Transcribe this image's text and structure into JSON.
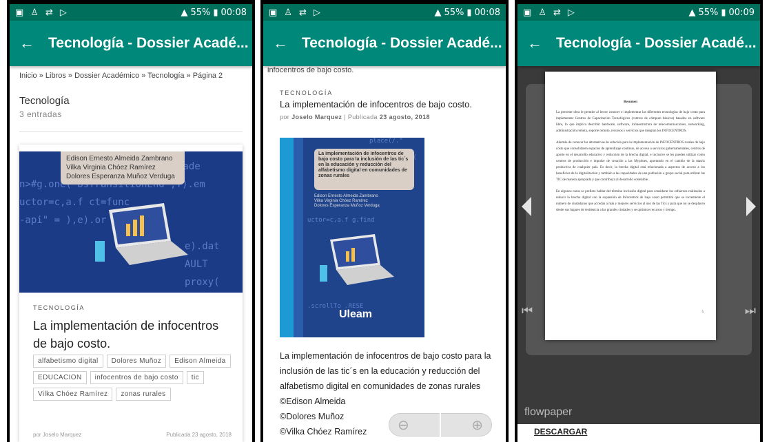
{
  "status": {
    "battery": "55%",
    "time_1": "00:08",
    "time_2": "00:08",
    "time_3": "00:09"
  },
  "appbar": {
    "title": "Tecnología - Dossier Acadé..."
  },
  "screen1": {
    "breadcrumb": "Inicio » Libros » Dossier Académico » Tecnología » Página 2",
    "category_title": "Tecnología",
    "entries": "3 entradas",
    "cover_authors": [
      "Edison Ernesto Almeida Zambrano",
      "Vilka Virginia Chóez Ramírez",
      "Dolores Esperanza Muñoz Verduga"
    ],
    "category": "TECNOLOGÍA",
    "post_title": "La implementación de infocentros de bajo costo.",
    "tags": [
      "alfabetismo digital",
      "Dolores Muñoz",
      "Edison Almeida",
      "EDUCACION",
      "infocentros de bajo costo",
      "tic",
      "Vilka Chóez Ramírez",
      "zonas rurales"
    ],
    "meta_author": "por Joselo Marquez",
    "meta_date": "Publicada 23 agosto, 2018"
  },
  "screen2": {
    "top_text": "infocentros de bajo costo.",
    "category": "TECNOLOGÍA",
    "post_title": "La implementación de infocentros de bajo costo.",
    "meta_prefix": "por",
    "meta_author": "Joselo Marquez",
    "meta_sep": "|",
    "meta_pub": "Publicada",
    "meta_date": "23 agosto, 2018",
    "book_title": "La implementación de infocentros de bajo costo para la inclusión de las tic´s en la educación y reducción del alfabetismo digital en comunidades de zonas rurales",
    "book_authors": [
      "Edison Ernesto Almeida Zambrano",
      "Vilka Virginia Chóez Ramírez",
      "Dolores Esperanza Muñoz Verduga"
    ],
    "book_logo": "Uleam",
    "desc_line1": "La implementación de infocentros de bajo costo para la",
    "desc_line2": "inclusión de las tic´s en la educación y reducción del",
    "desc_line3": "alfabetismo digital en comunidades de zonas rurales",
    "credit1": "©Edison Almeida",
    "credit2": "©Dolores Muñoz",
    "credit3": "©Vilka Chóez Ramírez"
  },
  "screen3": {
    "doc_heading": "Resumen",
    "doc_p1": "La presente obra le permite al lector conocer e implementar las diferentes tecnologías de bajo costo para implementar Centros de Capacitación Tecnológicos (centros de cómputo básicos) basados en software libre, lo que implica describir hardware, software, infraestructura de telecomunicaciones, networking, administración remota, soporte remoto, recursos y servicios que integran los INFOCENTROS.",
    "doc_p2": "Además de conocer las alternativas de solución para la implementación de INFOCENTROS rurales de bajo costo que consolidaren espacios de aprendizaje continuo, de acceso a servicios gubernamentales, centros de aporte en el desarrollo educativo y reducción de la brecha digital, e inclusive se les pueden utilizar como centros de producción e impulso de creación a las Mypimes, aportando en el cambio de la matriz productiva de cualquier país. Es decir, la brecha digital está relacionada a aspectos de acceso a los beneficios de la digitalización y también a las capacidades de una población o grupo social para utilizar las TIC de manera apropiada y que contribuya al desarrollo sostenible.",
    "doc_p3": "En algunos casos se prefiere hablar del término inclusión digital para considerar los esfuerzos realizados a reducir la brecha digital con la expansión de Infocentros de bajo costo permitirá que se incremente el número de ciudadanos que accedan a más y mejores servicios al uso de las Tics y para que no se desplacen desde sus lugares de residencia a las grandes ciudades y se optimice recursos y tiempo.",
    "page_number": "5",
    "viewer_brand": "flowpaper",
    "download": "DESCARGAR"
  }
}
